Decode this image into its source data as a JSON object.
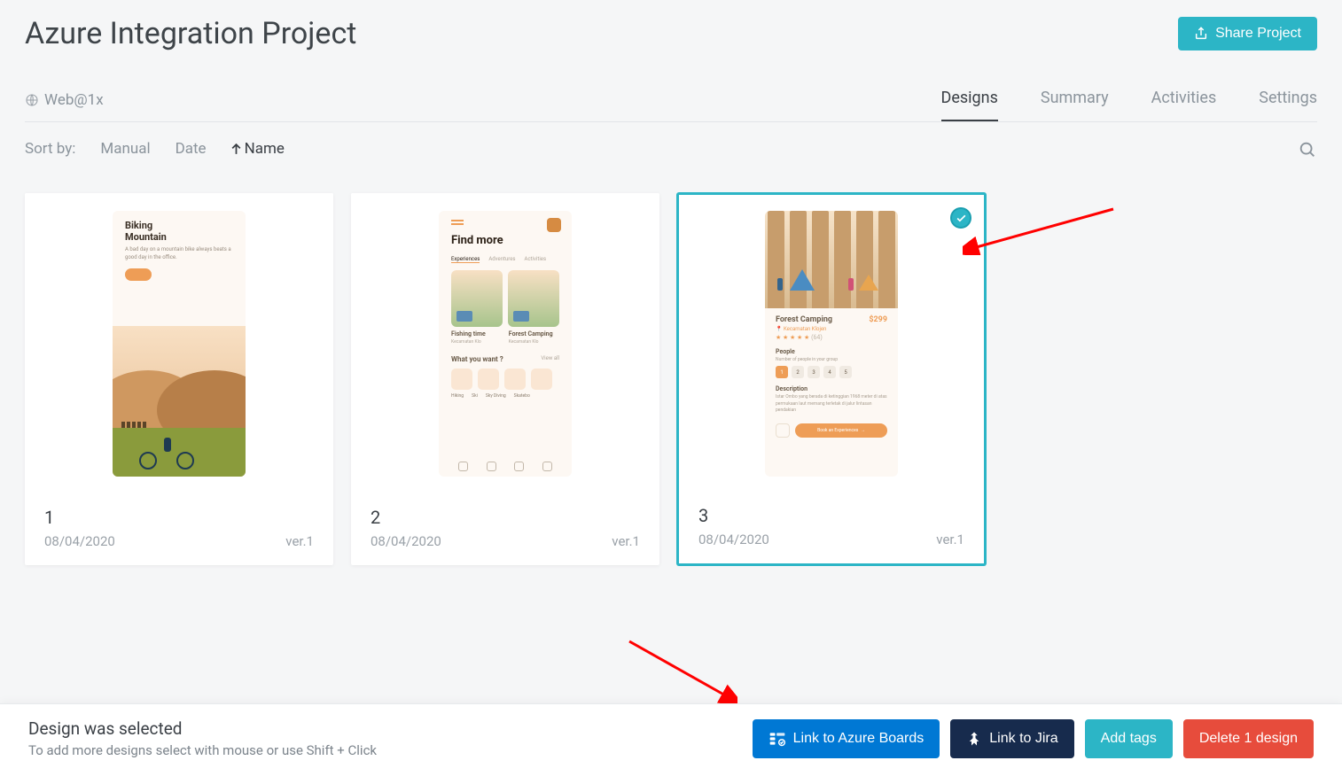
{
  "header": {
    "title": "Azure Integration Project",
    "share_label": "Share Project"
  },
  "platform": "Web@1x",
  "tabs": {
    "designs": "Designs",
    "summary": "Summary",
    "activities": "Activities",
    "settings": "Settings"
  },
  "sort": {
    "label": "Sort by:",
    "manual": "Manual",
    "date": "Date",
    "name": "Name"
  },
  "cards": [
    {
      "name": "1",
      "date": "08/04/2020",
      "version": "ver.1",
      "selected": false,
      "mock": {
        "title": "Biking",
        "subtitle": "Mountain",
        "blurb": "A bad day on a mountain bike always beats a good day in the office."
      }
    },
    {
      "name": "2",
      "date": "08/04/2020",
      "version": "ver.1",
      "selected": false,
      "mock": {
        "title": "Find more",
        "tab1": "Experiences",
        "tab2": "Adventures",
        "tab3": "Activities",
        "cap1": "Fishing time",
        "cap2": "Forest Camping",
        "loc": "Kecamatan Klo",
        "q": "What you want ?",
        "viewall": "View all",
        "l1": "Hiking",
        "l2": "Ski",
        "l3": "Sky Diving",
        "l4": "Skatebo"
      }
    },
    {
      "name": "3",
      "date": "08/04/2020",
      "version": "ver.1",
      "selected": true,
      "mock": {
        "title": "Forest Camping",
        "price": "$299",
        "loc": "Kecamatan Klojen",
        "people": "People",
        "people_sub": "Number of people in your group",
        "desc": "Description",
        "desc_text": "Istar Ombo yang berada di ketinggian 1968 meter di atas permukaan laut memang terletak di jalur lintasan pendakian",
        "book": "Book an Experiences"
      }
    }
  ],
  "bottom": {
    "title": "Design was selected",
    "hint": "To add more designs select with mouse or use Shift + Click",
    "azure": "Link to Azure Boards",
    "jira": "Link to Jira",
    "tags": "Add tags",
    "delete": "Delete 1 design"
  }
}
